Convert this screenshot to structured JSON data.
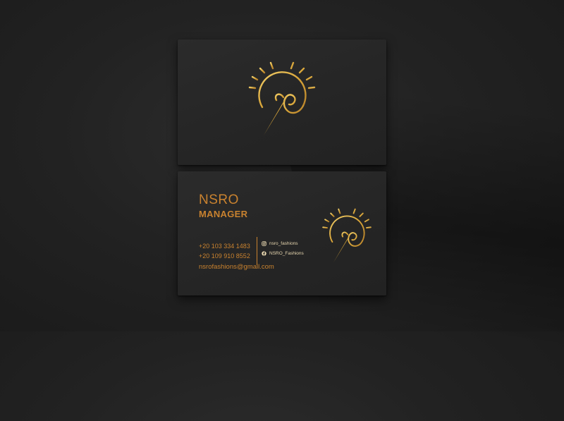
{
  "colors": {
    "background": "#242424",
    "card": "#272727",
    "foil_gold": "#d9a63a",
    "text_copper": "#c9822f"
  },
  "front": {
    "logo_icon": "sun-with-sewing-needle-logo"
  },
  "back": {
    "name": "NSRO",
    "title": "MANAGER",
    "phones": [
      "+20 103 334 1483",
      "+20 109 910 8552"
    ],
    "email": "nsrofashions@gmail.com",
    "social": [
      {
        "icon": "instagram-icon",
        "handle": "nsro_fashions"
      },
      {
        "icon": "facebook-icon",
        "handle": "NSRO_Fashions"
      }
    ],
    "logo_icon": "sun-with-sewing-needle-logo"
  }
}
